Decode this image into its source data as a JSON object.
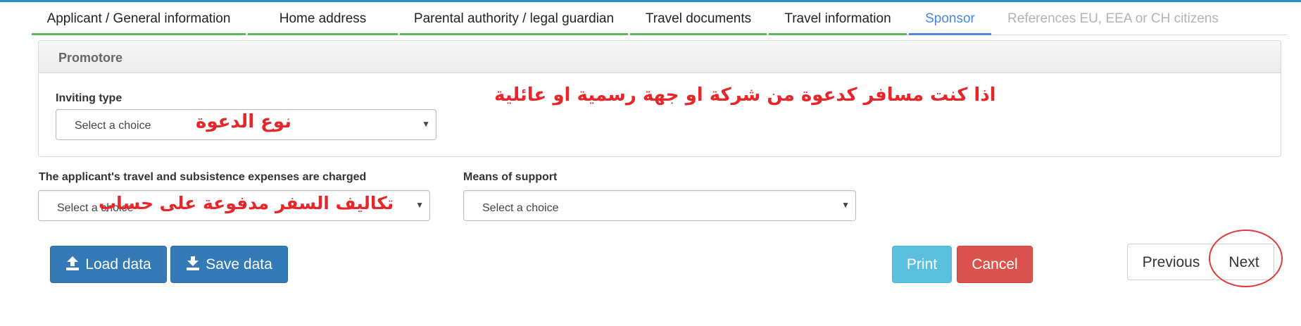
{
  "tabs": [
    {
      "label": "Applicant / General information",
      "state": "done"
    },
    {
      "label": "Home address",
      "state": "done"
    },
    {
      "label": "Parental authority / legal guardian",
      "state": "done"
    },
    {
      "label": "Travel documents",
      "state": "done"
    },
    {
      "label": "Travel information",
      "state": "done"
    },
    {
      "label": "Sponsor",
      "state": "active"
    },
    {
      "label": "References EU, EEA or CH citizens",
      "state": "disabled"
    }
  ],
  "panel": {
    "title": "Promotore",
    "inviting_type": {
      "label": "Inviting type",
      "placeholder": "Select a choice"
    }
  },
  "expenses": {
    "label": "The applicant's travel and subsistence expenses are charged",
    "placeholder": "Select a choice"
  },
  "support": {
    "label": "Means of support",
    "placeholder": "Select a choice"
  },
  "buttons": {
    "load": "Load data",
    "save": "Save data",
    "print": "Print",
    "cancel": "Cancel",
    "previous": "Previous",
    "next": "Next"
  },
  "annotations": {
    "invite_note": "اذا كنت مسافر كدعوة من شركة او جهة رسمية او عائلية",
    "invite_type": "نوع الدعوة",
    "expenses_note": "تكاليف السفر مدفوعة على حساب"
  },
  "colors": {
    "tab_done": "#5cb85c",
    "tab_active": "#4a86e8",
    "primary": "#337ab7",
    "info": "#5bc0de",
    "danger": "#d9534f",
    "annotation": "#e8262a"
  },
  "icons": {
    "upload": "upload-icon",
    "download": "download-icon",
    "caret": "caret-down-icon"
  }
}
